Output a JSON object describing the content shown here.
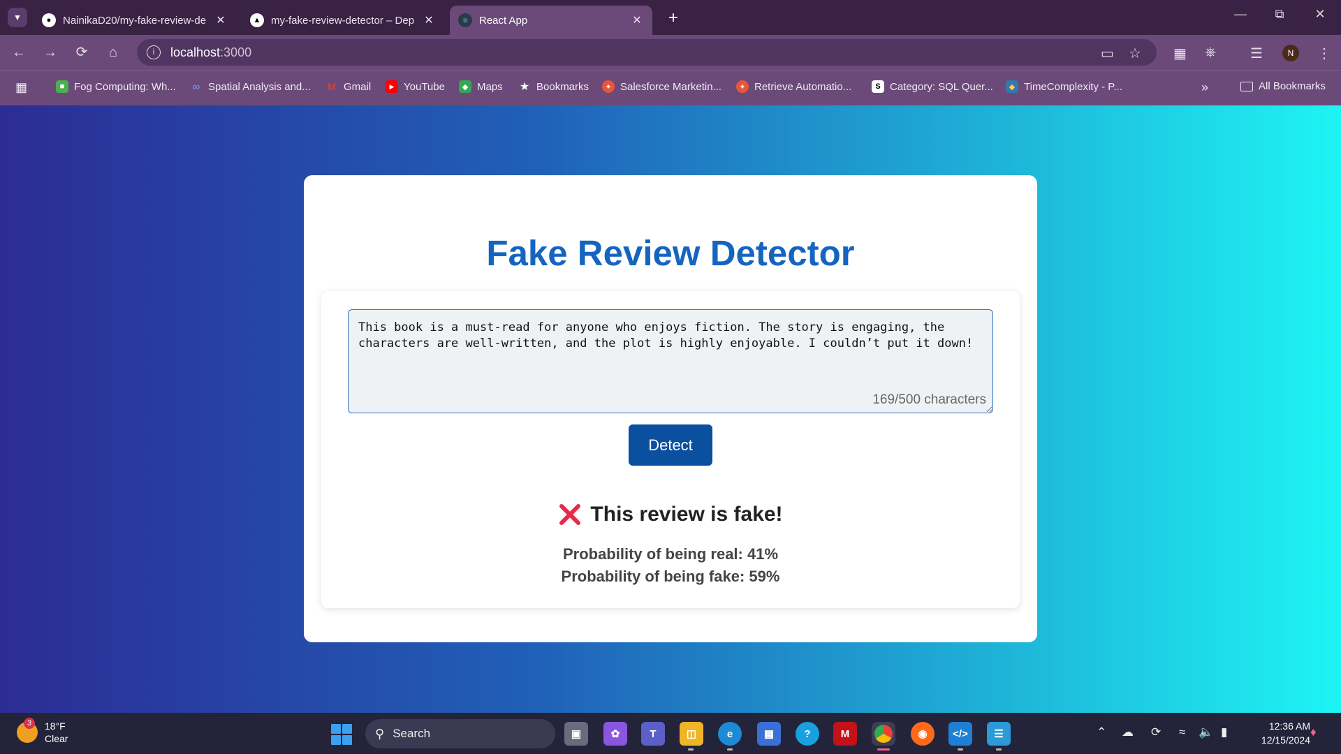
{
  "browser": {
    "tabs": [
      {
        "title": "NainikaD20/my-fake-review-de",
        "favicon": "github-icon"
      },
      {
        "title": "my-fake-review-detector – Dep",
        "favicon": "vercel-icon"
      },
      {
        "title": "React App",
        "favicon": "react-icon",
        "active": true
      }
    ],
    "url_host": "localhost",
    "url_port": ":3000",
    "profile_initial": "N",
    "bookmarks": [
      {
        "label": "Fog Computing: Wh...",
        "icon": "cube-icon"
      },
      {
        "label": "Spatial Analysis and...",
        "icon": "infinity-icon"
      },
      {
        "label": "Gmail",
        "icon": "gmail-icon"
      },
      {
        "label": "YouTube",
        "icon": "youtube-icon"
      },
      {
        "label": "Maps",
        "icon": "maps-icon"
      },
      {
        "label": "Bookmarks",
        "icon": "star-icon"
      },
      {
        "label": "Salesforce Marketin...",
        "icon": "salesforce-icon"
      },
      {
        "label": "Retrieve Automatio...",
        "icon": "salesforce-icon"
      },
      {
        "label": "Category: SQL Quer...",
        "icon": "s-icon"
      },
      {
        "label": "TimeComplexity - P...",
        "icon": "python-icon"
      }
    ],
    "all_bookmarks_label": "All Bookmarks"
  },
  "app": {
    "title": "Fake Review Detector",
    "review_text": "This book is a must-read for anyone who enjoys fiction. The story is engaging, the characters are well-written, and the plot is highly enjoyable. I couldn’t put it down!",
    "char_count": "169/500 characters",
    "detect_label": "Detect",
    "result_text": "This review is fake!",
    "prob_real": "Probability of being real: 41%",
    "prob_fake": "Probability of being fake: 59%",
    "result_color": "#e8294a",
    "title_color": "#1565c0",
    "button_color": "#0b4f9f"
  },
  "taskbar": {
    "weather_badge": "3",
    "temperature": "18°F",
    "condition": "Clear",
    "search_label": "Search",
    "time": "12:36 AM",
    "date": "12/15/2024"
  }
}
